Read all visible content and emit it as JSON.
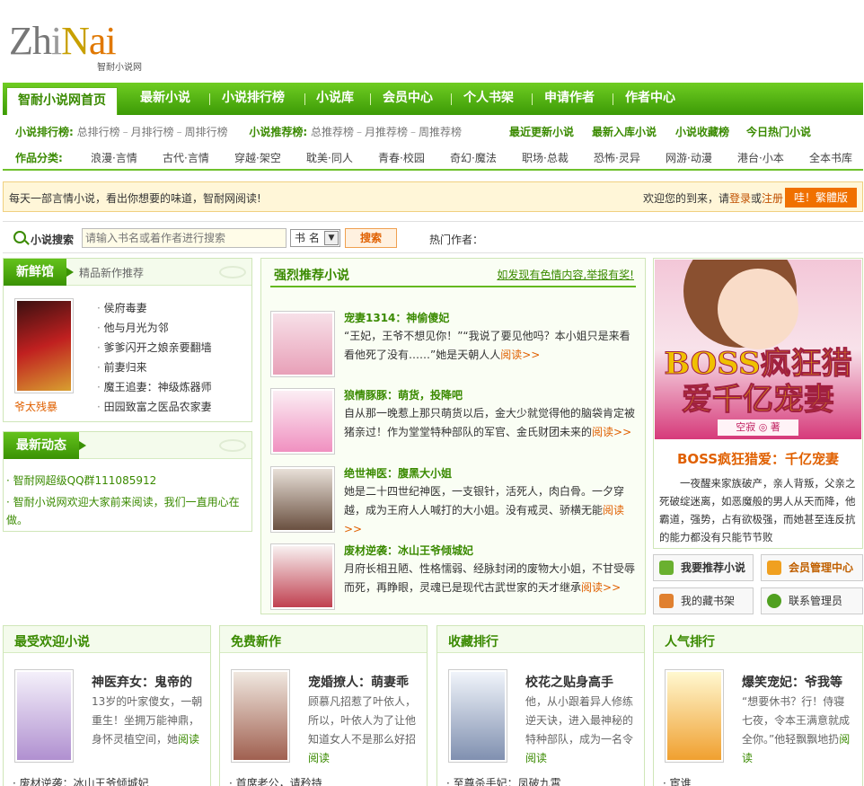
{
  "logo": {
    "text_z": "Zh",
    "text_i": "i",
    "text_n": "N",
    "text_ai": "ai",
    "sub": "智耐小说网"
  },
  "nav": {
    "items": [
      "智耐小说网首页",
      "最新小说",
      "小说排行榜",
      "小说库",
      "会员中心",
      "个人书架",
      "申请作者",
      "作者中心"
    ]
  },
  "subnav": {
    "rank_label": "小说排行榜:",
    "rank_items": [
      "总排行榜",
      "月排行榜",
      "周排行榜"
    ],
    "rec_label": "小说推荐榜:",
    "rec_items": [
      "总推荐榜",
      "月推荐榜",
      "周推荐榜"
    ],
    "bold_links": [
      "最近更新小说",
      "最新入库小说",
      "小说收藏榜",
      "今日热门小说"
    ],
    "cat_label": "作品分类:",
    "categories": [
      "浪漫·言情",
      "古代·言情",
      "穿越·架空",
      "耽美·同人",
      "青春·校园",
      "奇幻·魔法",
      "职场·总裁",
      "恐怖·灵异",
      "网游·动漫",
      "港台·小本",
      "全本书库"
    ]
  },
  "notice": {
    "left": "每天一部言情小说，看出你想要的味道，智耐网阅读!",
    "welcome": "欢迎您的到来，请",
    "login": "登录",
    "or": "或",
    "register": "注册",
    "trad_btn": "哇！繁體版"
  },
  "search": {
    "label": "小说搜索",
    "placeholder": "请输入书名或着作者进行搜索",
    "select": "书 名",
    "button": "搜索",
    "hot": "热门作者："
  },
  "fresh": {
    "tab": "新鲜馆",
    "desc": "精品新作推荐",
    "cover_title": "爷太残暴",
    "items": [
      "侯府毒妻",
      "他与月光为邻",
      "爹爹闪开之娘亲要翻墙",
      "前妻归来",
      "魔王追妻：神级炼器师",
      "田园致富之医品农家妻"
    ]
  },
  "news": {
    "tab": "最新动态",
    "line1": "智耐网超级QQ群111085912",
    "line2": "智耐小说网欢迎大家前来阅读，我们一直用心在做。"
  },
  "recommend": {
    "title": "强烈推荐小说",
    "report": "如发现有色情内容,举报有奖!",
    "more": "阅读>>",
    "items": [
      {
        "title": "宠妻1314：神偷傻妃",
        "desc": "“王妃，王爷不想见你！”“我说了要见他吗？本小姐只是来看看他死了没有……”她是天朝人人"
      },
      {
        "title": "狼情豚豚：萌货，投降吧",
        "desc": "自从那一晚惹上那只萌货以后，金大少就觉得他的脑袋肯定被猪亲过！作为堂堂特种部队的军官、金氏财团未来的"
      },
      {
        "title": "绝世神医：腹黑大小姐",
        "desc": "她是二十四世纪神医，一支银针，活死人，肉白骨。一夕穿越，成为王府人人喊打的大小姐。没有戒灵、骄横无能"
      },
      {
        "title": "废材逆袭：冰山王爷倾城妃",
        "desc": "月府长相丑陋、性格懦弱、经脉封闭的废物大小姐，不甘受辱而死，再睁眼，灵魂已是现代古武世家的天才继承"
      }
    ]
  },
  "ad": {
    "big": "BOSS疯狂猎爱千亿宠妻",
    "author": "空寂 ◎ 著",
    "title": "BOSS疯狂猎爱：千亿宠妻",
    "desc": "一夜醒来家族破产，亲人背叛，父亲之死破绽迷离，如恶魔般的男人从天而降，他霸道，强势，占有欲极强，而她甚至连反抗的能力都没有只能节节败"
  },
  "buttons": [
    "我要推荐小说",
    "会员管理中心",
    "我的藏书架",
    "联系管理员"
  ],
  "bottom": [
    {
      "head": "最受欢迎小说",
      "title": "神医弃女：鬼帝的",
      "desc": "13岁的叶家傻女，一朝重生！坐拥万能神鼎，身怀灵植空间，她",
      "more": "阅读",
      "foot": "废材逆袭：冰山王爷倾城妃"
    },
    {
      "head": "免费新作",
      "title": "宠婚撩人：萌妻乖",
      "desc": "顾慕凡招惹了叶依人，所以，叶依人为了让他知道女人不是那么好招",
      "more": "阅读",
      "foot": "首席老公，请矜持"
    },
    {
      "head": "收藏排行",
      "title": "校花之贴身高手",
      "desc": "他，从小跟着异人修练逆天诀，进入最神秘的特种部队，成为一名令",
      "more": "阅读",
      "foot": "至尊杀手妃：凤破九霄"
    },
    {
      "head": "人气排行",
      "title": "爆笑宠妃：爷我等",
      "desc": "“想要休书？行！侍寝七夜，令本王满意就成全你。”他轻飘飘地扔",
      "more": "阅读",
      "foot": "宦谁"
    }
  ],
  "colors": {
    "brand_green": "#3a8a00",
    "accent_orange": "#e06000"
  }
}
